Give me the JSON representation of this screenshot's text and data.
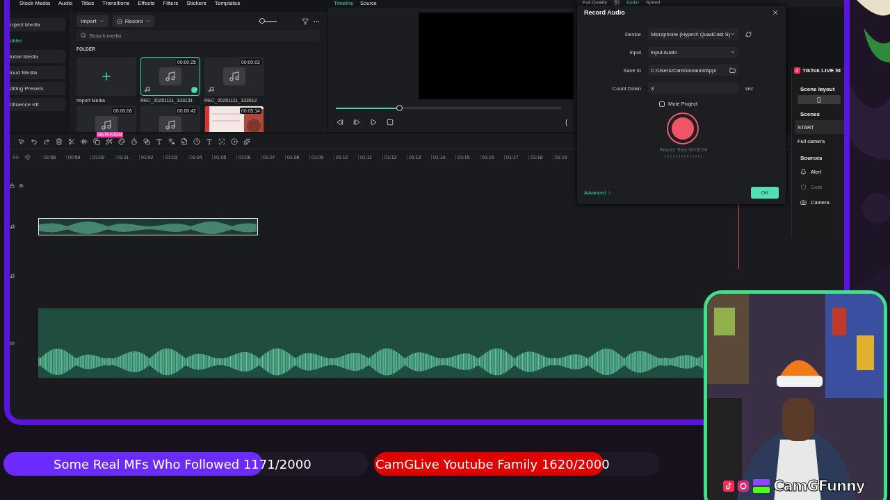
{
  "editor": {
    "top_tabs": [
      "Stock Media",
      "Audio",
      "Titles",
      "Transitions",
      "Effects",
      "Filters",
      "Stickers",
      "Templates"
    ],
    "sidebar": [
      {
        "label": "roject Media",
        "selected": false
      },
      {
        "label": "older",
        "selected": true
      },
      {
        "label": "lobal Media",
        "selected": false
      },
      {
        "label": "loud Media",
        "selected": false
      },
      {
        "label": "diting Presets",
        "selected": false
      },
      {
        "label": "nfluence Kit",
        "selected": false
      }
    ],
    "media": {
      "zoom": {
        "level": 0.2
      },
      "buttons": [
        "Import",
        "Record"
      ],
      "search": {
        "placeholder": "Search media"
      },
      "folder_label": "FOLDER",
      "items": [
        {
          "kind": "import",
          "label": "Import Media",
          "selected": false
        },
        {
          "kind": "audio",
          "label": "REC_20251111_133131",
          "duration": "00:00:25",
          "selected": true
        },
        {
          "kind": "audio",
          "label": "REC_20251111_133012",
          "duration": "00:00:02",
          "selected": false
        },
        {
          "kind": "audio",
          "duration": "00:00:06",
          "selected": false
        },
        {
          "kind": "audio",
          "duration": "00:00:42",
          "selected": false
        },
        {
          "kind": "video",
          "duration": "00:05:14",
          "selected": false
        }
      ]
    },
    "player": {
      "tabs": [
        {
          "label": "Timeline",
          "selected": true
        },
        {
          "label": "Source",
          "selected": false
        }
      ],
      "scrubber": {
        "level": 0.28
      },
      "mark_in": "{"
    },
    "properties": {
      "quality": "Full Quality",
      "tabs": [
        {
          "label": "Audio",
          "selected": true
        },
        {
          "label": "Speed",
          "selected": false
        }
      ]
    },
    "timeline": {
      "badges": [
        "NEW",
        "NEW"
      ],
      "ruler": [
        "00:58",
        "00:59",
        "01:00",
        "01:01",
        "01:02",
        "01:03",
        "01:04",
        "01:05",
        "01:06",
        "01:07",
        "01:08",
        "01:09",
        "01:10",
        "01:11",
        "01:12",
        "01:13",
        "01:14",
        "01:15",
        "01:16",
        "01:17",
        "01:18",
        "01:19"
      ]
    }
  },
  "record_dialog": {
    "title": "Record Audio",
    "fields": [
      {
        "kind": "select",
        "label": "Device",
        "value": "Microphone (HyperX QuadCast S)"
      },
      {
        "kind": "select",
        "label": "Input",
        "value": "Input Audio"
      },
      {
        "kind": "path",
        "label": "Save to",
        "value": "C:/Users/CamGiovanni/Appl"
      },
      {
        "kind": "number",
        "label": "Count Down",
        "value": "3",
        "unit": "sec"
      }
    ],
    "mute_project": {
      "label": "Mute Project",
      "checked": false
    },
    "record_time": "Record Time 00:00:00",
    "advanced": "Advanced",
    "ok": "OK"
  },
  "tiktok_panel": {
    "title": "TikTok LIVE St",
    "layout_heading": "Scene layout",
    "scenes_heading": "Scenes",
    "scenes": [
      {
        "label": "START",
        "selected": true
      },
      {
        "label": "Full camera",
        "selected": false
      }
    ],
    "sources_heading": "Sources",
    "sources": [
      {
        "kind": "alert",
        "label": "Alert",
        "disabled": false
      },
      {
        "kind": "goal",
        "label": "Goal",
        "disabled": true
      },
      {
        "kind": "camera",
        "label": "Camera",
        "disabled": false
      }
    ]
  },
  "goals": [
    {
      "text": "Some Real MFs Who Followed 1171/2000",
      "level": 0.71,
      "color": "#6b2bff"
    },
    {
      "text": "CamGLive Youtube Family 1620/2000",
      "level": 0.8,
      "color": "#e00000"
    }
  ],
  "webcam": {
    "handle": "CamGFunny"
  }
}
